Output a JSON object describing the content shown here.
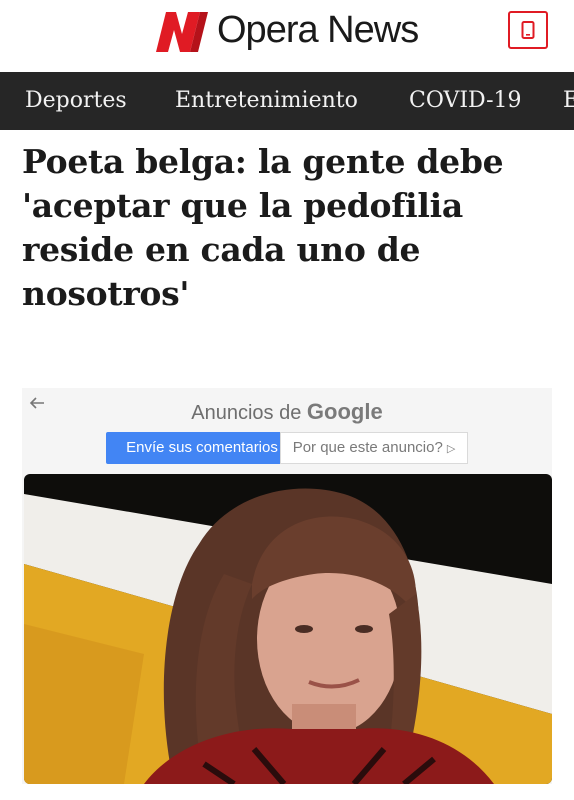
{
  "header": {
    "brand_name": "Opera News",
    "logo_icon": "opera-news-n-icon",
    "app_button_icon": "phone-icon",
    "accent_color": "#e01b24"
  },
  "nav": {
    "items": [
      {
        "label": "Deportes"
      },
      {
        "label": "Entretenimiento"
      },
      {
        "label": "COVID-19"
      },
      {
        "label": "E"
      }
    ]
  },
  "article": {
    "title_lines": [
      "Poeta belga: la gente debe",
      "'aceptar que la pedofilia",
      "reside en cada uno de",
      "nosotros'"
    ]
  },
  "ad": {
    "label_prefix": "Anuncios de",
    "label_brand": "Google",
    "feedback_label": "Envíe sus comentarios",
    "why_label": "Por que este anuncio?",
    "back_icon": "back-arrow-icon",
    "why_icon": "play-triangle-icon"
  },
  "image": {
    "subject": "article-photo"
  }
}
